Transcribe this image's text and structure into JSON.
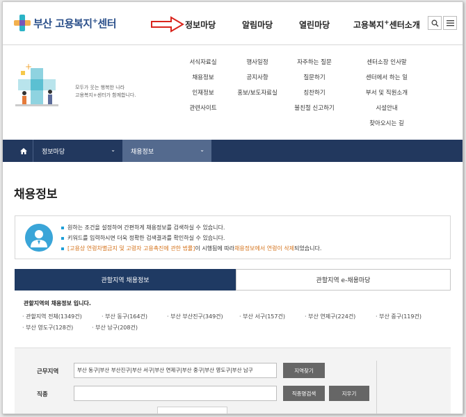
{
  "header": {
    "logo_main": "부산 고용복지",
    "logo_plus": "+",
    "logo_tail": "센터",
    "gnb": [
      {
        "label": "정보마당"
      },
      {
        "label": "알림마당"
      },
      {
        "label": "열린마당"
      },
      {
        "label_pre": "고용복지",
        "label_sup": "+",
        "label_post": "센터소개"
      }
    ],
    "search_icon": "search-icon",
    "menu_icon": "hamburger-menu-icon"
  },
  "mega_menu": {
    "slogan_line1": "모두가 웃는 행복한 나라",
    "slogan_line2": "고용복지+센터가 함께합니다.",
    "col1": [
      "서식자료실",
      "채용정보",
      "인재정보",
      "관련사이트"
    ],
    "col2": [
      "행사일정",
      "공지사항",
      "홍보/보도자료실"
    ],
    "col3": [
      "자주하는 질문",
      "질문하기",
      "칭찬하기",
      "불친절 신고하기"
    ],
    "col4": [
      "센터소장 인사말",
      "센터에서 하는 일",
      "부서 및 직원소개",
      "시설안내",
      "찾아오시는 길"
    ]
  },
  "breadcrumb": {
    "home_icon": "home-icon",
    "level1": "정보마당",
    "level2": "채용정보"
  },
  "page": {
    "title": "채용정보",
    "info": {
      "line1": "원하는 조건을 설정하여 간편하게 채용정보를 검색하실 수 있습니다.",
      "line2": "키워드를 입력하시면 더욱 정확한 검색결과를 확인하실 수 있습니다.",
      "line3_a": "[고용상 연령차별금지 및 고령자 고용촉진에 관한 법률]",
      "line3_b": "이 시행됨에 따라 ",
      "line3_c": "채용정보에서 연령이 삭제",
      "line3_d": " 되었습니다."
    },
    "tabs": [
      "관할지역 채용정보",
      "관할지역 e-채용마당"
    ],
    "region_title": "관할지역의 채용정보 입니다.",
    "regions": [
      "관할지역 전체(1349건)",
      "부산 동구(164건)",
      "부산 부산진구(349건)",
      "부산 서구(157건)",
      "부산 연제구(224건)",
      "부산 중구(119건)",
      "부산 영도구(128건)",
      "부산 남구(208건)"
    ],
    "search": {
      "location_label": "근무지역",
      "location_value": "부산 동구|부산 부산진구|부산 서구|부산 연제구|부산 중구|부산 영도구|부산 남구",
      "find_region_btn": "지역찾기",
      "job_label": "직종",
      "job_value": "",
      "job_search_btn": "직종명검색",
      "clear_btn": "지우기"
    }
  },
  "colors": {
    "navy": "#1f3a63",
    "accent_blue": "#1e9fd8",
    "annotation_red": "#d9241c",
    "orange_text": "#d4721a"
  }
}
